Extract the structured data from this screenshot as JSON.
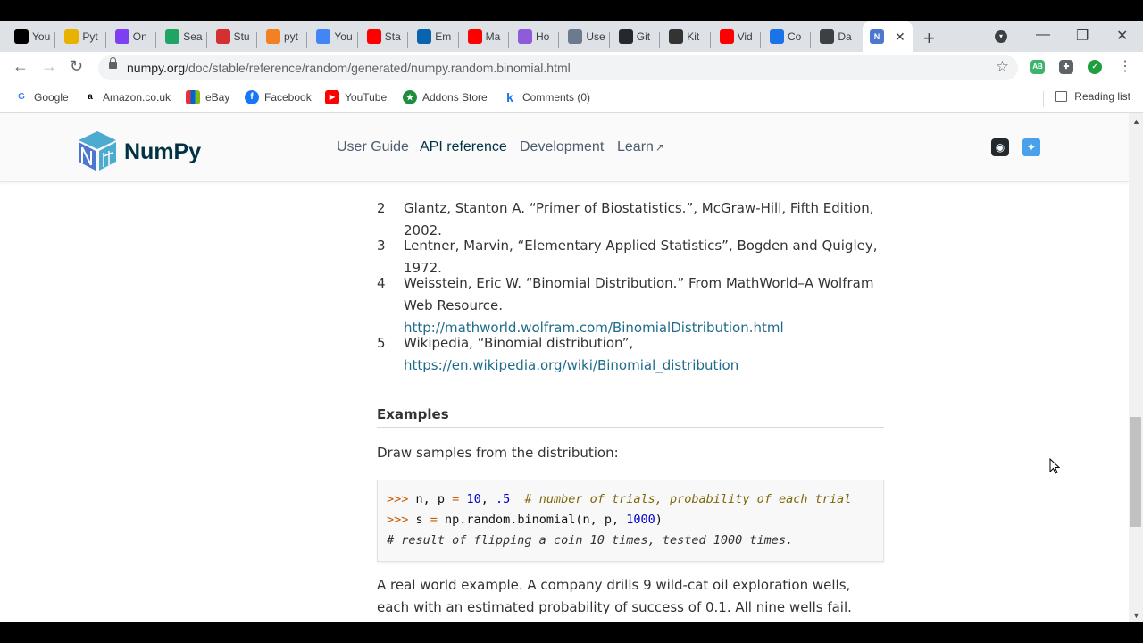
{
  "browser": {
    "tabs": [
      {
        "title": "You",
        "icon": "youtube-tab-icon",
        "color": "#000000"
      },
      {
        "title": "Pyt",
        "icon": "cc-tab-icon",
        "color": "#e8b200"
      },
      {
        "title": "On",
        "icon": "onion-tab-icon",
        "color": "#7e3ff2"
      },
      {
        "title": "Sea",
        "icon": "drive-tab-icon",
        "color": "#1fa463"
      },
      {
        "title": "Stu",
        "icon": "cc-red-tab-icon",
        "color": "#d3302f"
      },
      {
        "title": "pyt",
        "icon": "stackoverflow-tab-icon",
        "color": "#f48024"
      },
      {
        "title": "You",
        "icon": "docs-tab-icon",
        "color": "#4285f4"
      },
      {
        "title": "Sta",
        "icon": "youtube-red-tab-icon",
        "color": "#ff0000"
      },
      {
        "title": "Em",
        "icon": "outlook-tab-icon",
        "color": "#0a64ad"
      },
      {
        "title": "Ma",
        "icon": "youtube-red-tab-icon",
        "color": "#ff0000"
      },
      {
        "title": "Ho",
        "icon": "s-tab-icon",
        "color": "#8e5cd9"
      },
      {
        "title": "Use",
        "icon": "globe-tab-icon",
        "color": "#6b7a8c"
      },
      {
        "title": "Git",
        "icon": "github-tab-icon",
        "color": "#24292e"
      },
      {
        "title": "Kit",
        "icon": "kite-tab-icon",
        "color": "#333333"
      },
      {
        "title": "Vid",
        "icon": "youtube-red-tab-icon",
        "color": "#ff0000"
      },
      {
        "title": "Co",
        "icon": "k-tab-icon",
        "color": "#1a73e8"
      },
      {
        "title": "Da",
        "icon": "dash-tab-icon",
        "color": "#3c4043"
      }
    ],
    "active_tab_close": "✕",
    "new_tab": "+",
    "url_host": "numpy.org",
    "url_path": "/doc/stable/reference/random/generated/numpy.random.binomial.html",
    "bookmarks": [
      {
        "label": "Google",
        "icon": "G"
      },
      {
        "label": "Amazon.co.uk",
        "icon": "a"
      },
      {
        "label": "eBay",
        "icon": ""
      },
      {
        "label": "Facebook",
        "icon": "f"
      },
      {
        "label": "YouTube",
        "icon": "▶"
      },
      {
        "label": "Addons Store",
        "icon": "★"
      },
      {
        "label": "Comments (0)",
        "icon": "k"
      }
    ],
    "reading_list": "Reading list",
    "ext_ab": "AB"
  },
  "site": {
    "logo_text": "NumPy",
    "nav": [
      "User Guide",
      "API reference",
      "Development",
      "Learn"
    ]
  },
  "refs": [
    {
      "num": "2",
      "text": "Glantz, Stanton A. “Primer of Biostatistics.”, McGraw-Hill, Fifth Edition, 2002.",
      "link": ""
    },
    {
      "num": "3",
      "text": "Lentner, Marvin, “Elementary Applied Statistics”, Bogden and Quigley, 1972.",
      "link": ""
    },
    {
      "num": "4",
      "text": "Weisstein, Eric W. “Binomial Distribution.” From MathWorld–A Wolfram Web Resource. ",
      "link": "http://mathworld.wolfram.com/BinomialDistribution.html"
    },
    {
      "num": "5",
      "text": "Wikipedia, “Binomial distribution”, ",
      "link": "https://en.wikipedia.org/wiki/Binomial_distribution"
    }
  ],
  "examples_heading": "Examples",
  "draw_text": "Draw samples from the distribution:",
  "code": {
    "p1": ">>> ",
    "l1_a": "n, p ",
    "l1_eq": "=",
    "l1_n1": "10",
    "l1_comma": ", ",
    "l1_n2": ".5",
    "l1_cm": "  # number of trials, probability of each trial",
    "p2": ">>> ",
    "l2_a": "s ",
    "l2_eq": "=",
    "l2_b": " np.random.binomial(n, p, ",
    "l2_n": "1000",
    "l2_c": ")",
    "l3": "# result of flipping a coin 10 times, tested 1000 times."
  },
  "real_world_text": "A real world example. A company drills 9 wild-cat oil exploration wells, each with an estimated probability of success of 0.1. All nine wells fail. What is the"
}
